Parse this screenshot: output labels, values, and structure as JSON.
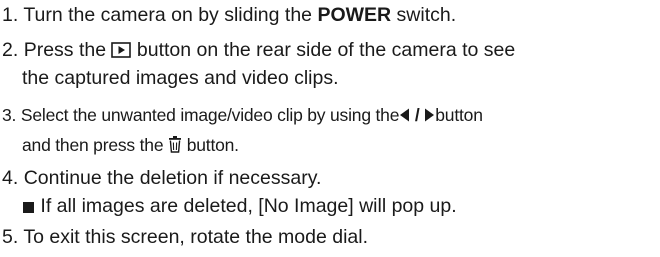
{
  "steps": [
    {
      "number": "1.",
      "text_before": "Turn the camera on by sliding the",
      "bold": "POWER",
      "text_after": "switch."
    },
    {
      "number": "2.",
      "text_before": "Press the",
      "icon": "play-button-icon",
      "text_after": "button on the rear side of the camera to see",
      "continuation": "the captured images and video clips."
    },
    {
      "number": "3.",
      "text_before": "Select the unwanted image/video clip by using the",
      "icons": [
        "left-arrow-icon",
        "right-arrow-icon"
      ],
      "separator": "/",
      "text_after": "button",
      "continuation_before": "and then press the",
      "continuation_icon": "trash-icon",
      "continuation_after": "button."
    },
    {
      "number": "4.",
      "text": "Continue the deletion if necessary.",
      "note_icon": "square-bullet-icon",
      "note": "If all images are deleted, [No Image] will pop up."
    },
    {
      "number": "5.",
      "text": "To exit this screen, rotate the mode dial."
    }
  ]
}
